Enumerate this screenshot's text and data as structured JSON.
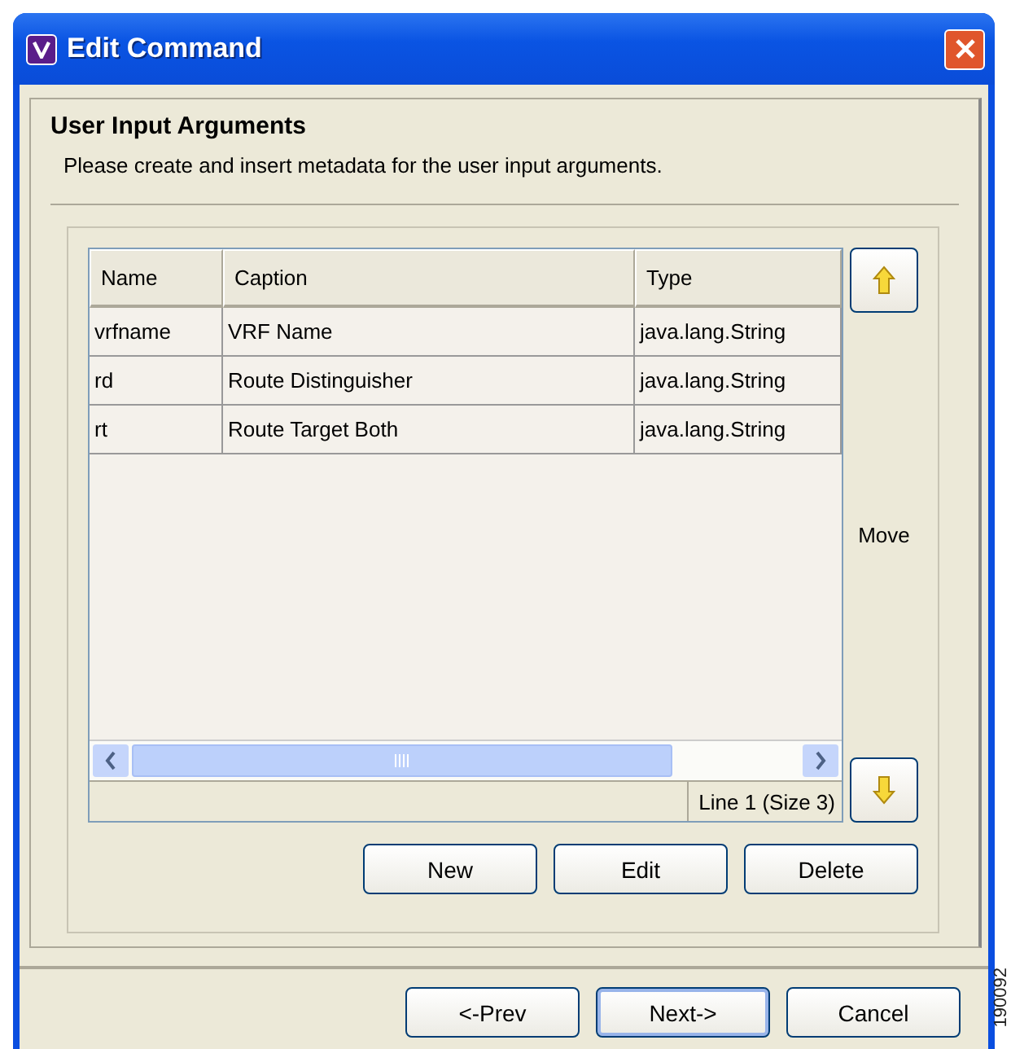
{
  "window": {
    "title": "Edit Command"
  },
  "header": {
    "title": "User Input Arguments",
    "description": "Please create and insert metadata for the user input arguments."
  },
  "table": {
    "columns": [
      "Name",
      "Caption",
      "Type"
    ],
    "rows": [
      [
        "vrfname",
        "VRF Name",
        "java.lang.String"
      ],
      [
        "rd",
        "Route Distinguisher",
        "java.lang.String"
      ],
      [
        "rt",
        "Route Target Both",
        "java.lang.String"
      ]
    ],
    "status": "Line 1 (Size 3)"
  },
  "move_label": "Move",
  "row_buttons": [
    "New",
    "Edit",
    "Delete"
  ],
  "footer_buttons": [
    {
      "label": "<-Prev",
      "selected": false
    },
    {
      "label": "Next->",
      "selected": true
    },
    {
      "label": "Cancel",
      "selected": false
    }
  ],
  "figure_id": "190092"
}
